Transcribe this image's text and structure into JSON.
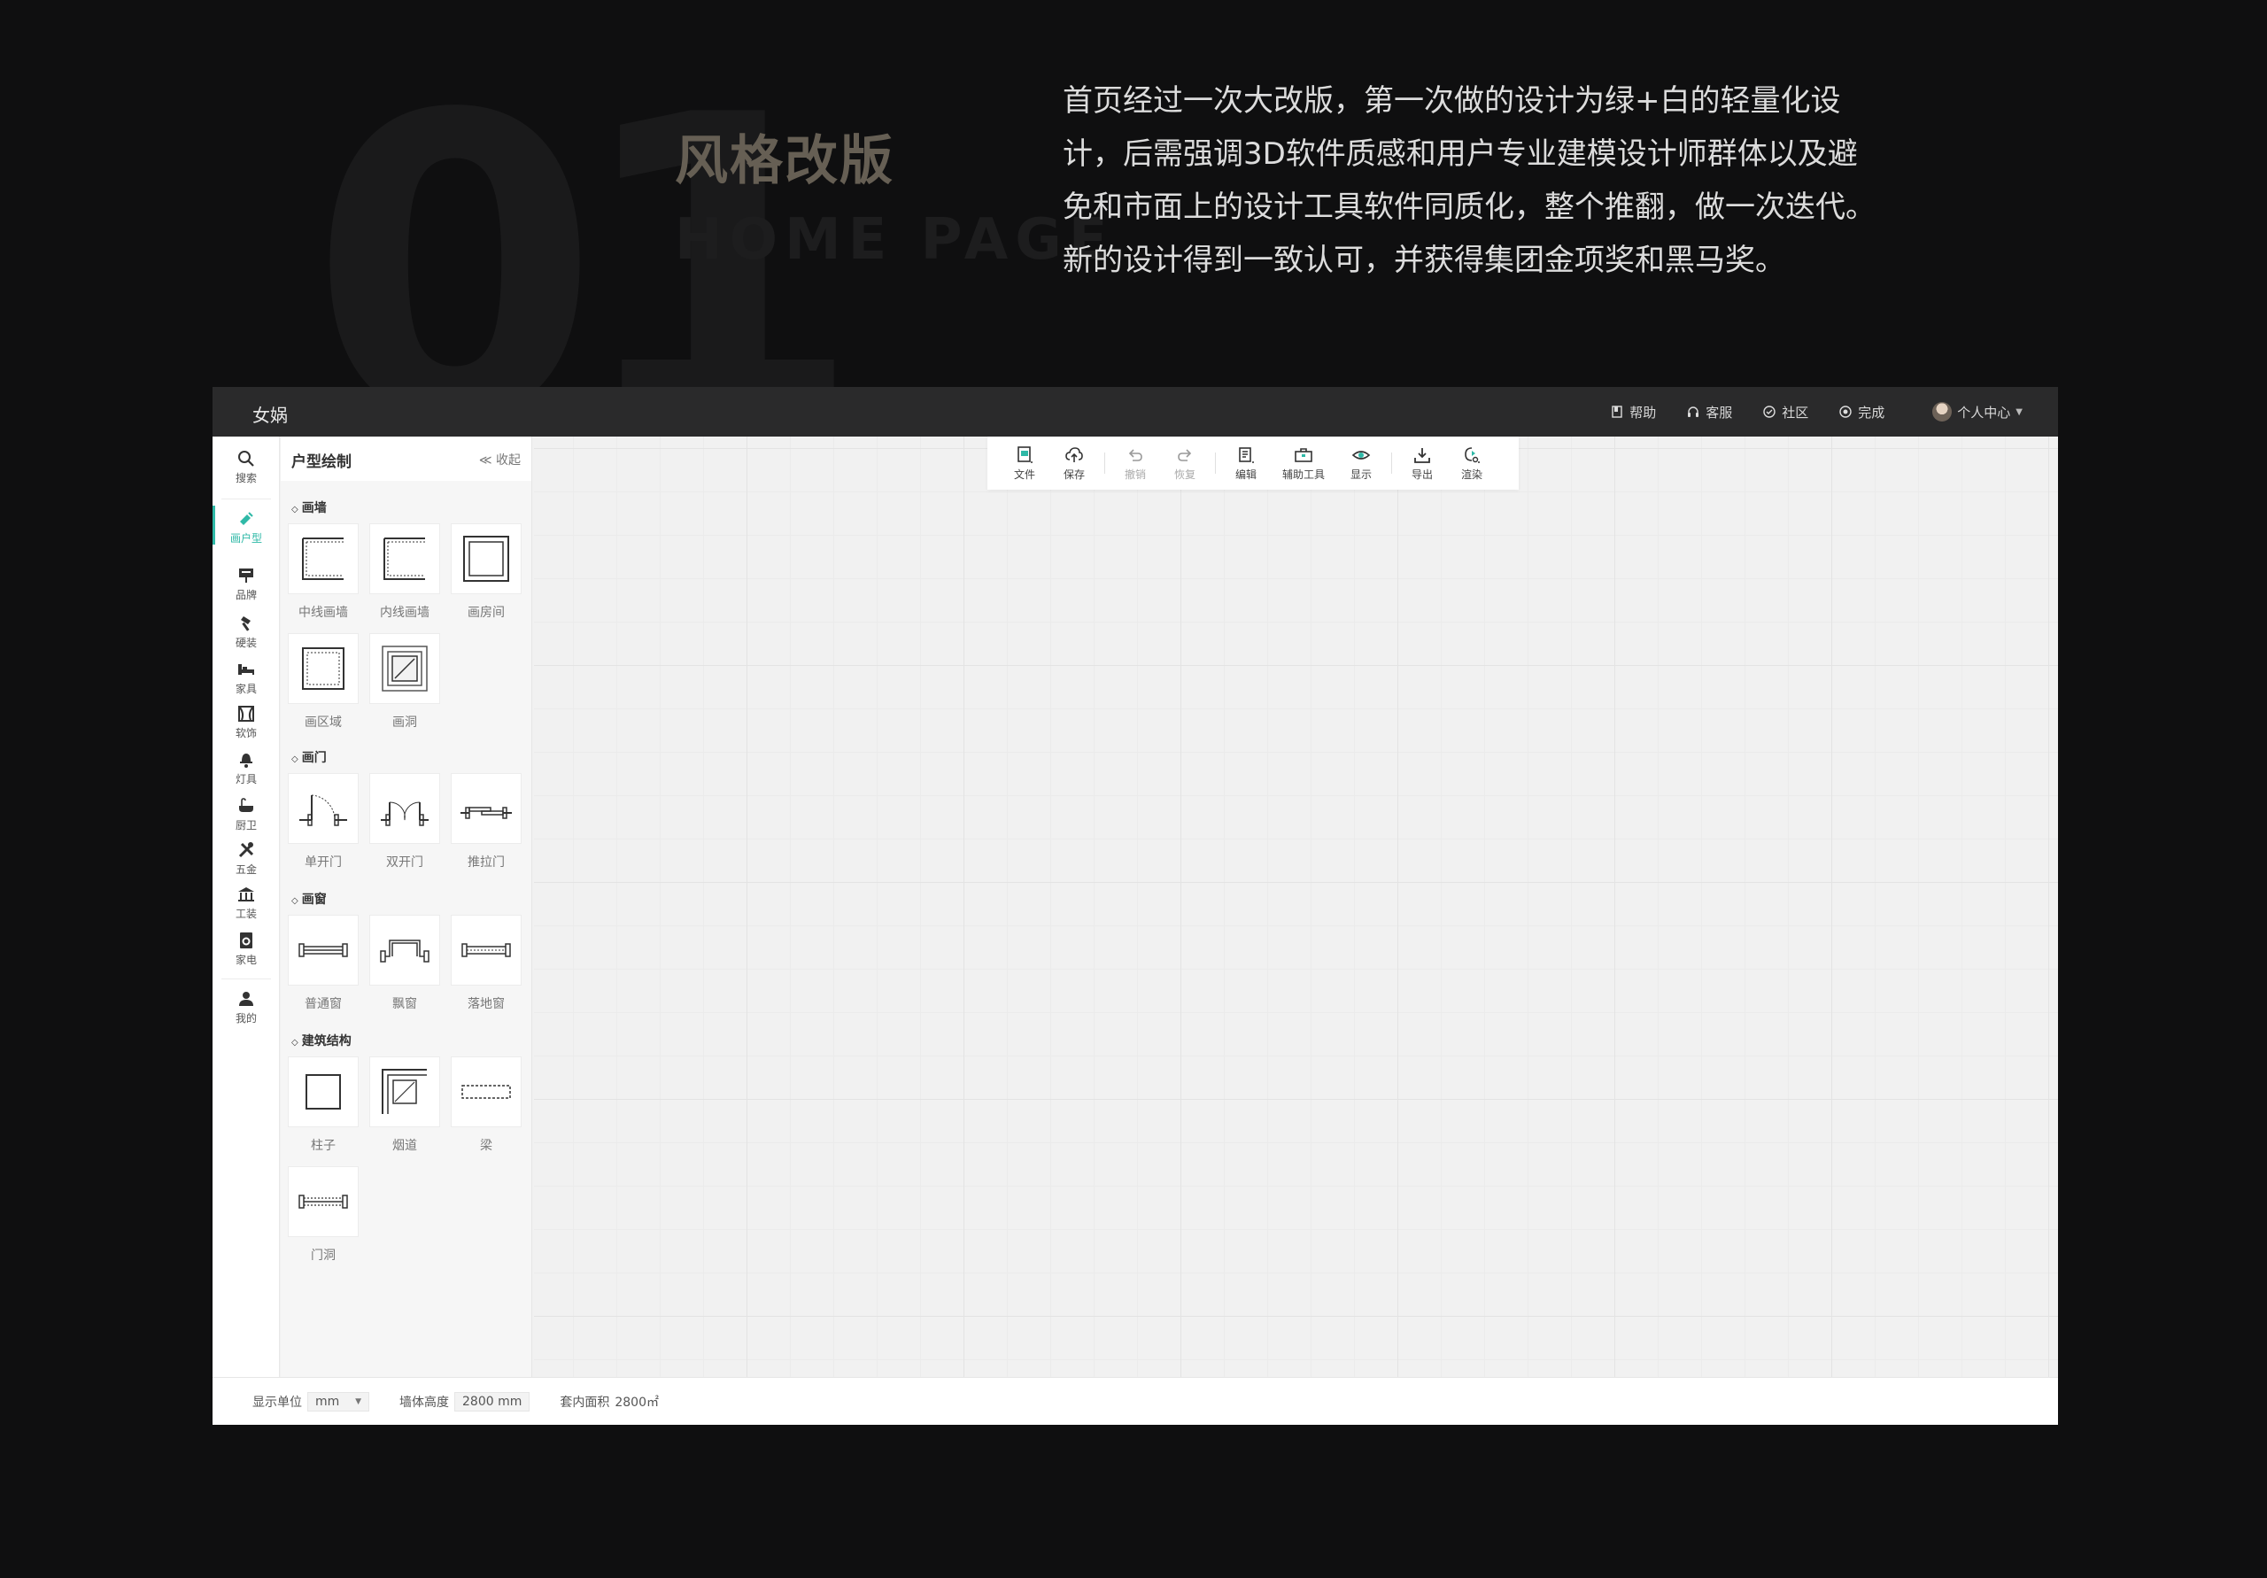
{
  "hero": {
    "number": "01",
    "title": "风格改版",
    "subtitle": "HOME PAGE",
    "description": "首页经过一次大改版，第一次做的设计为绿+白的轻量化设计，后需强调3D软件质感和用户专业建模设计师群体以及避免和市面上的设计工具软件同质化，整个推翻，做一次迭代。新的设计得到一致认可，并获得集团金项奖和黑马奖。"
  },
  "app": {
    "logo": "女娲",
    "top_links": [
      {
        "label": "帮助",
        "icon": "help-book-icon"
      },
      {
        "label": "客服",
        "icon": "headset-icon"
      },
      {
        "label": "社区",
        "icon": "community-icon"
      },
      {
        "label": "完成",
        "icon": "finish-icon"
      }
    ],
    "user": {
      "label": "个人中心",
      "icon": "avatar"
    },
    "rail": [
      {
        "label": "搜索",
        "icon": "search-icon"
      },
      {
        "label": "画户型",
        "icon": "draw-floorplan-icon",
        "active": true
      },
      {
        "label": "品牌",
        "icon": "brand-sign-icon"
      },
      {
        "label": "硬装",
        "icon": "hammer-icon"
      },
      {
        "label": "家具",
        "icon": "bed-icon"
      },
      {
        "label": "软饰",
        "icon": "curtain-icon"
      },
      {
        "label": "灯具",
        "icon": "lamp-icon"
      },
      {
        "label": "厨卫",
        "icon": "bathtub-icon"
      },
      {
        "label": "五金",
        "icon": "tools-icon"
      },
      {
        "label": "工装",
        "icon": "building-icon"
      },
      {
        "label": "家电",
        "icon": "washer-icon"
      },
      {
        "label": "我的",
        "icon": "user-icon"
      }
    ],
    "panel": {
      "title": "户型绘制",
      "collapse_label": "≪ 收起",
      "sections": [
        {
          "title": "画墙",
          "items": [
            "中线画墙",
            "内线画墙",
            "画房间",
            "画区域",
            "画洞"
          ]
        },
        {
          "title": "画门",
          "items": [
            "单开门",
            "双开门",
            "推拉门"
          ]
        },
        {
          "title": "画窗",
          "items": [
            "普通窗",
            "飘窗",
            "落地窗"
          ]
        },
        {
          "title": "建筑结构",
          "items": [
            "柱子",
            "烟道",
            "梁",
            "门洞"
          ]
        }
      ]
    },
    "toolbar": [
      {
        "label": "文件",
        "icon": "file-icon"
      },
      {
        "label": "保存",
        "icon": "cloud-upload-icon"
      },
      {
        "label": "撤销",
        "icon": "undo-icon",
        "disabled": true
      },
      {
        "label": "恢复",
        "icon": "redo-icon",
        "disabled": true
      },
      {
        "label": "编辑",
        "icon": "edit-doc-icon"
      },
      {
        "label": "辅助工具",
        "icon": "toolbox-icon"
      },
      {
        "label": "显示",
        "icon": "eye-icon"
      },
      {
        "label": "导出",
        "icon": "download-icon"
      },
      {
        "label": "渲染",
        "icon": "render-icon"
      }
    ],
    "status": {
      "unit_label": "显示单位",
      "unit_value": "mm",
      "wall_height_label": "墙体高度",
      "wall_height_value": "2800 mm",
      "area_label": "套内面积",
      "area_value": "2800㎡"
    },
    "colors": {
      "accent": "#2fb9a7",
      "topbar": "#2a2a2b",
      "page_bg": "#0f0f10"
    }
  }
}
